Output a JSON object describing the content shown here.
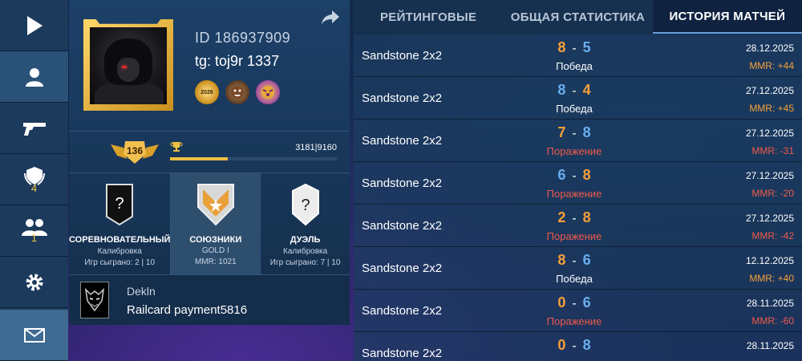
{
  "sidebar": {
    "items": [
      {
        "name": "play-icon"
      },
      {
        "name": "profile-icon"
      },
      {
        "name": "weapon-icon"
      },
      {
        "name": "achievements-icon",
        "count": "4"
      },
      {
        "name": "friends-icon",
        "count": "1"
      },
      {
        "name": "settings-icon"
      },
      {
        "name": "mail-icon"
      }
    ]
  },
  "profile": {
    "id": "ID 186937909",
    "name": "tg: toj9r 1337",
    "badges": [
      "2026",
      "",
      ""
    ],
    "level": "136",
    "xp_text": "3181|9160",
    "xp_fraction": 0.347,
    "ranks": [
      {
        "title": "СОРЕВНОВАТЕЛЬНЫЙ",
        "sub": "Калибровка",
        "games": "Игр сыграно: 2 | 10"
      },
      {
        "title": "СОЮЗНИКИ",
        "sub": "GOLD I",
        "games": "MMR: 1021"
      },
      {
        "title": "ДУЭЛЬ",
        "sub": "Калибровка",
        "games": "Игр сыграно: 7 | 10"
      }
    ],
    "clan": {
      "name": "Dekln",
      "motto": "Railcard payment5816"
    }
  },
  "tabs": [
    {
      "label": "РЕЙТИНГОВЫЕ"
    },
    {
      "label": "ОБЩАЯ СТАТИСТИКА"
    },
    {
      "label": "ИСТОРИЯ МАТЧЕЙ"
    }
  ],
  "matches": [
    {
      "map": "Sandstone 2x2",
      "left": "8",
      "right": "5",
      "left_color": "orange",
      "right_color": "blue",
      "result": "Победа",
      "win": true,
      "date": "28.12.2025",
      "mmr": "MMR: +44"
    },
    {
      "map": "Sandstone 2x2",
      "left": "8",
      "right": "4",
      "left_color": "blue",
      "right_color": "orange",
      "result": "Победа",
      "win": true,
      "date": "27.12.2025",
      "mmr": "MMR: +45"
    },
    {
      "map": "Sandstone 2x2",
      "left": "7",
      "right": "8",
      "left_color": "orange",
      "right_color": "blue",
      "result": "Поражение",
      "win": false,
      "date": "27.12.2025",
      "mmr": "MMR: -31"
    },
    {
      "map": "Sandstone 2x2",
      "left": "6",
      "right": "8",
      "left_color": "blue",
      "right_color": "orange",
      "result": "Поражение",
      "win": false,
      "date": "27.12.2025",
      "mmr": "MMR: -20"
    },
    {
      "map": "Sandstone 2x2",
      "left": "2",
      "right": "8",
      "left_color": "orange",
      "right_color": "orange",
      "result": "Поражение",
      "win": false,
      "date": "27.12.2025",
      "mmr": "MMR: -42"
    },
    {
      "map": "Sandstone 2x2",
      "left": "8",
      "right": "6",
      "left_color": "orange",
      "right_color": "blue",
      "result": "Победа",
      "win": true,
      "date": "12.12.2025",
      "mmr": "MMR: +40"
    },
    {
      "map": "Sandstone 2x2",
      "left": "0",
      "right": "6",
      "left_color": "orange",
      "right_color": "blue",
      "result": "Поражение",
      "win": false,
      "date": "28.11.2025",
      "mmr": "MMR: -60"
    },
    {
      "map": "Sandstone 2x2",
      "left": "0",
      "right": "8",
      "left_color": "orange",
      "right_color": "blue",
      "result": "",
      "win": false,
      "date": "28.11.2025",
      "mmr": ""
    }
  ],
  "colors": {
    "orange": "#f5a03a",
    "blue": "#6aaef0",
    "loss": "#f05a4a",
    "gold": "#f0c040"
  }
}
